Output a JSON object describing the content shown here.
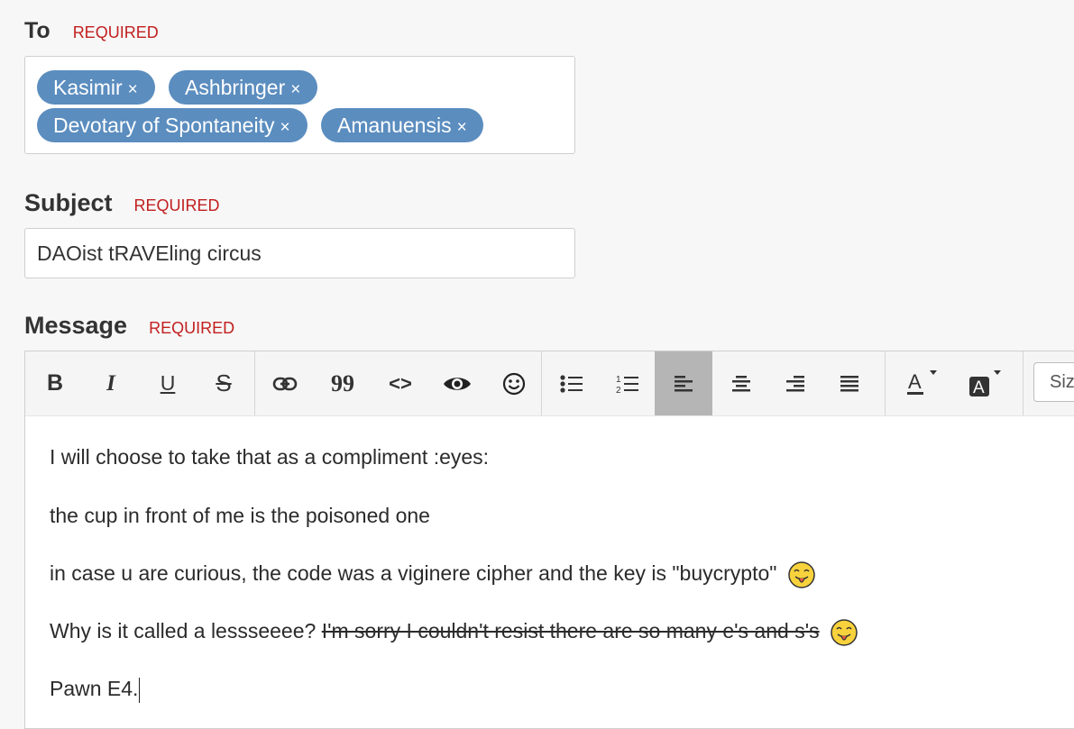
{
  "to": {
    "label": "To",
    "required": "REQUIRED",
    "recipients": [
      {
        "name": "Kasimir",
        "remove": "×"
      },
      {
        "name": "Ashbringer",
        "remove": "×"
      },
      {
        "name": "Devotary of Spontaneity",
        "remove": "×"
      },
      {
        "name": "Amanuensis",
        "remove": "×"
      }
    ]
  },
  "subject": {
    "label": "Subject",
    "required": "REQUIRED",
    "value": "DAOist tRAVEling circus"
  },
  "message": {
    "label": "Message",
    "required": "REQUIRED",
    "toolbar": {
      "bold": "B",
      "italic": "I",
      "underline": "U",
      "strike": "S",
      "quote": "99",
      "code": "<>",
      "size": "Size",
      "active_button": "align-left",
      "icons": [
        "link-icon",
        "eye-icon",
        "emoji-icon",
        "bullet-list-icon",
        "numbered-list-icon",
        "align-left-icon",
        "align-center-icon",
        "align-right-icon",
        "align-justify-icon",
        "font-color-icon",
        "background-color-icon"
      ]
    },
    "body": {
      "line1": "I will choose to take that as a compliment :eyes:",
      "line2": "the cup in front of me is the poisoned one",
      "line3": "in case u are curious, the code was a viginere cipher and the key is \"buycrypto\"",
      "line4_plain": "Why is it called a lessseeee? ",
      "line4_strike": "I'm sorry I couldn't resist there are so many e's and s's",
      "line5": "Pawn E4."
    }
  },
  "colors": {
    "pill": "#5b8dbf",
    "required": "#c21f1f",
    "active_toolbar": "#b5b5b5"
  }
}
